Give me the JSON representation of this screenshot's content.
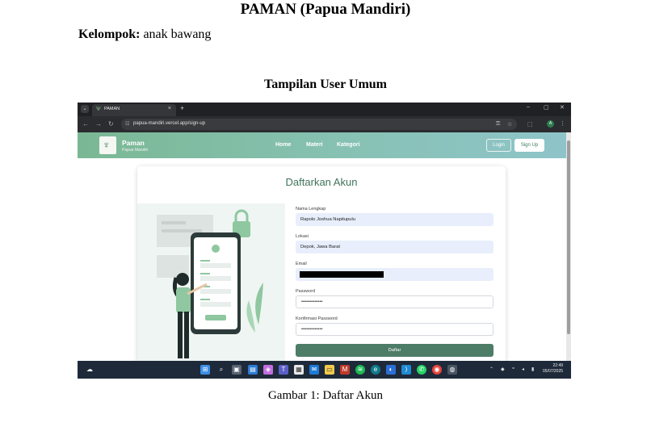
{
  "document": {
    "title": "PAMAN (Papua Mandiri)",
    "group_label": "Kelompok:",
    "group_value": "anak bawang",
    "section_title": "Tampilan User Umum",
    "caption": "Gambar 1: Daftar Akun"
  },
  "browser": {
    "tab_title": "PAMAN",
    "tab_close": "×",
    "new_tab": "+",
    "url": "papua-mandiri.vercel.app/sign-up",
    "profile_initial": "A",
    "window_controls": [
      "–",
      "▢",
      "✕"
    ]
  },
  "site": {
    "brand_name": "Paman",
    "brand_sub": "Papua Mandiri",
    "nav_links": [
      "Home",
      "Materi",
      "Kategori"
    ],
    "login_label": "Login",
    "signup_label": "Sign Up",
    "accent_color": "#4e7d67"
  },
  "form": {
    "title": "Daftarkan Akun",
    "fields": [
      {
        "label": "Nama Lengkap",
        "value": "Rapolo Joshua Napitupulu"
      },
      {
        "label": "Lokasi",
        "value": "Depok, Jawa Barat"
      },
      {
        "label": "Email",
        "value": ""
      },
      {
        "label": "Password",
        "value": "•••••••••••••"
      },
      {
        "label": "Konfirmasi Password",
        "value": "•••••••••••••"
      }
    ],
    "submit_label": "Daftar"
  },
  "taskbar": {
    "time": "22:49",
    "date": "05/07/2025",
    "icons": [
      "start-icon",
      "search-icon",
      "task-view-icon",
      "widgets-icon",
      "copilot-icon",
      "teams-icon",
      "store-icon",
      "explorer-icon",
      "mcafee-icon",
      "files-icon",
      "spotify-icon",
      "edge-icon",
      "chrome-icon",
      "vscode-icon",
      "whatsapp-icon",
      "chrome-icon",
      "app-icon"
    ]
  }
}
